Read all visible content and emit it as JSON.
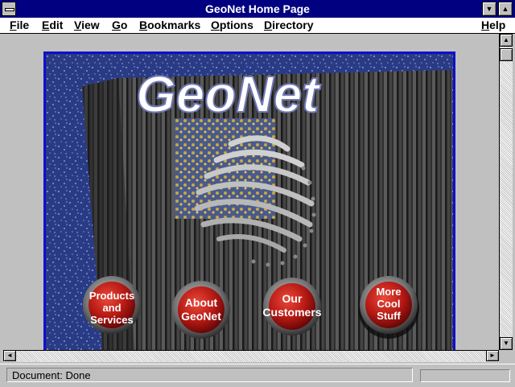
{
  "window": {
    "title": "GeoNet Home Page"
  },
  "menu": {
    "file": "File",
    "edit": "Edit",
    "view": "View",
    "go": "Go",
    "bookmarks": "Bookmarks",
    "options": "Options",
    "directory": "Directory",
    "help": "Help"
  },
  "page": {
    "logo": "GeoNet",
    "buttons": [
      {
        "line1": "Products",
        "line2": "and",
        "line3": "Services"
      },
      {
        "line1": "About",
        "line2": "GeoNet"
      },
      {
        "line1": "Our",
        "line2": "Customers"
      },
      {
        "line1": "More",
        "line2": "Cool",
        "line3": "Stuff"
      }
    ]
  },
  "status": {
    "text": "Document: Done",
    "progress": 0
  },
  "icons": {
    "system_menu": "system-menu-icon",
    "minimize": "minimize-icon",
    "maximize": "maximize-icon",
    "scroll_up": "arrow-up-icon",
    "scroll_down": "arrow-down-icon",
    "scroll_left": "arrow-left-icon",
    "scroll_right": "arrow-right-icon"
  },
  "colors": {
    "title_bar": "#000080",
    "banner_border": "#1010c8",
    "button_red": "#c4201a"
  }
}
